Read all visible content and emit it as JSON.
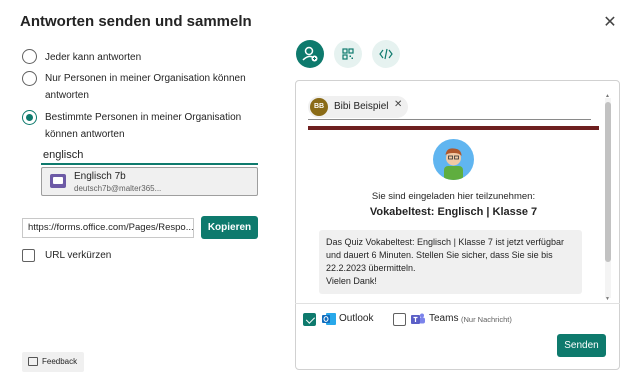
{
  "dialog": {
    "title": "Antworten senden und sammeln",
    "close_icon": "close-icon"
  },
  "audience": {
    "options": [
      {
        "label": "Jeder kann antworten",
        "selected": false
      },
      {
        "label_line1": "Nur Personen in meiner Organisation können",
        "label_line2": "antworten",
        "selected": false
      },
      {
        "label_line1": "Bestimmte Personen in meiner Organisation",
        "label_line2": "können antworten",
        "selected": true
      }
    ],
    "search_value": "englisch",
    "suggestion": {
      "name": "Englisch 7b",
      "email": "deutsch7b@malter365...",
      "icon": "group-icon"
    }
  },
  "link": {
    "url": "https://forms.office.com/Pages/Respo...",
    "copy_label": "Kopieren",
    "shorten_label": "URL verkürzen",
    "shorten_checked": false
  },
  "feedback": {
    "label": "Feedback",
    "icon": "feedback-icon"
  },
  "share_tabs": [
    {
      "name": "invite-people",
      "icon": "person-add-icon",
      "active": true
    },
    {
      "name": "qr-code",
      "icon": "qr-code-icon",
      "active": false
    },
    {
      "name": "embed",
      "icon": "code-icon",
      "active": false
    }
  ],
  "email_preview": {
    "recipient_initials": "BB",
    "recipient_name": "Bibi Beispiel",
    "remove_icon": "close-icon",
    "invite_text": "Sie sind eingeladen hier teilzunehmen:",
    "quiz_title": "Vokabeltest: Englisch | Klasse 7",
    "message_lines": [
      "Das Quiz Vokabeltest: Englisch | Klasse 7 ist jetzt verfügbar",
      "und dauert 6 Minuten. Stellen Sie sicher, dass Sie sie bis",
      "22.2.2023 übermitteln.",
      "Vielen Dank!"
    ]
  },
  "channels": {
    "outlook_label": "Outlook",
    "outlook_checked": true,
    "teams_label": "Teams",
    "teams_note": "(Nur Nachricht)",
    "teams_checked": false,
    "send_label": "Senden"
  },
  "colors": {
    "accent": "#0e7a6d",
    "banner": "#6e1f1f",
    "outlook": "#0f6cbd",
    "teams": "#5b5fc7"
  }
}
